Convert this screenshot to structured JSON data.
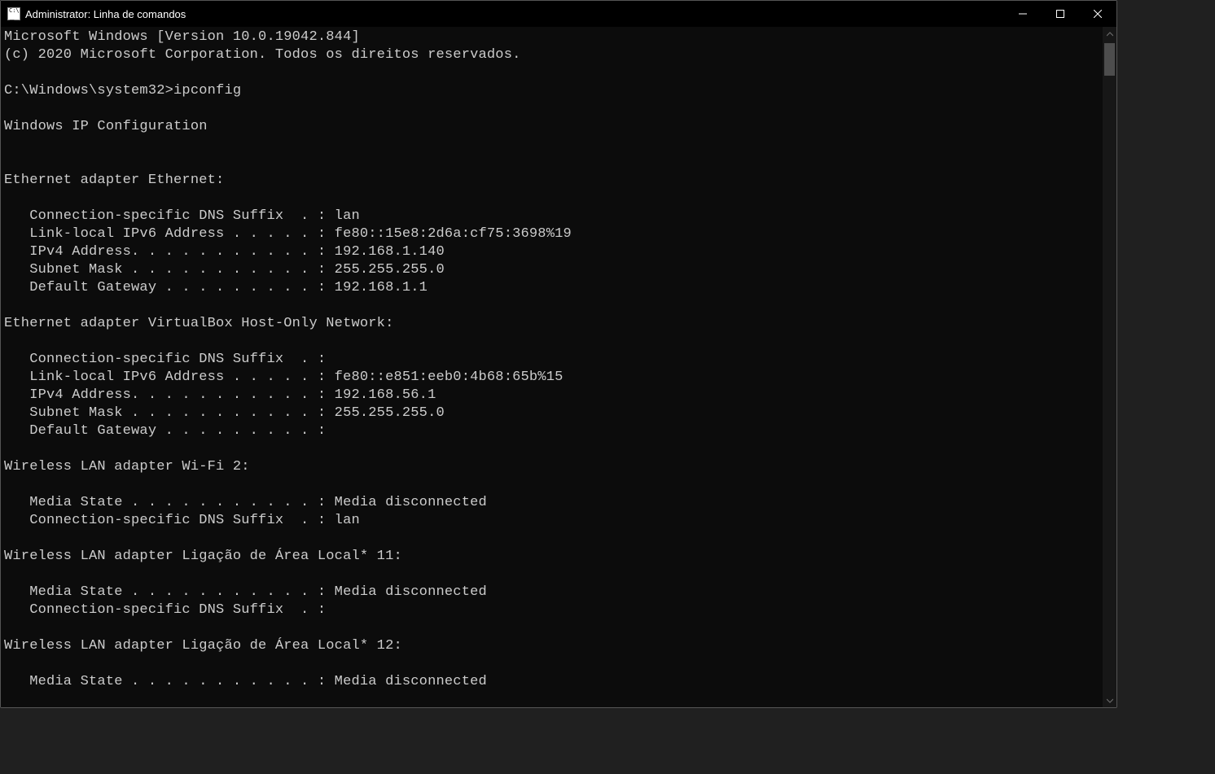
{
  "window": {
    "title": "Administrator: Linha de comandos"
  },
  "terminal": {
    "header1": "Microsoft Windows [Version 10.0.19042.844]",
    "header2": "(c) 2020 Microsoft Corporation. Todos os direitos reservados.",
    "prompt": "C:\\Windows\\system32>",
    "command": "ipconfig",
    "section_title": "Windows IP Configuration",
    "adapters": [
      {
        "heading": "Ethernet adapter Ethernet:",
        "lines": [
          "   Connection-specific DNS Suffix  . : lan",
          "   Link-local IPv6 Address . . . . . : fe80::15e8:2d6a:cf75:3698%19",
          "   IPv4 Address. . . . . . . . . . . : 192.168.1.140",
          "   Subnet Mask . . . . . . . . . . . : 255.255.255.0",
          "   Default Gateway . . . . . . . . . : 192.168.1.1"
        ]
      },
      {
        "heading": "Ethernet adapter VirtualBox Host-Only Network:",
        "lines": [
          "   Connection-specific DNS Suffix  . :",
          "   Link-local IPv6 Address . . . . . : fe80::e851:eeb0:4b68:65b%15",
          "   IPv4 Address. . . . . . . . . . . : 192.168.56.1",
          "   Subnet Mask . . . . . . . . . . . : 255.255.255.0",
          "   Default Gateway . . . . . . . . . :"
        ]
      },
      {
        "heading": "Wireless LAN adapter Wi-Fi 2:",
        "lines": [
          "   Media State . . . . . . . . . . . : Media disconnected",
          "   Connection-specific DNS Suffix  . : lan"
        ]
      },
      {
        "heading": "Wireless LAN adapter Ligação de Área Local* 11:",
        "lines": [
          "   Media State . . . . . . . . . . . : Media disconnected",
          "   Connection-specific DNS Suffix  . :"
        ]
      },
      {
        "heading": "Wireless LAN adapter Ligação de Área Local* 12:",
        "lines": [
          "   Media State . . . . . . . . . . . : Media disconnected"
        ]
      }
    ]
  }
}
